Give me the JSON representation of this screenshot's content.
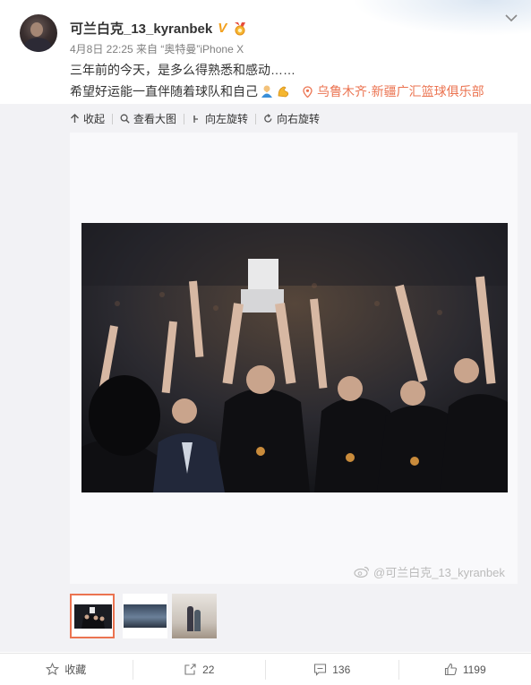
{
  "post": {
    "username": "可兰白克_13_kyranbek",
    "verified_badge": "V",
    "meta": "4月8日 22:25 来自 “奥特曼”iPhone X",
    "text_line1": "三年前的今天，是多么得熟悉和感动……",
    "text_line2": "希望好运能一直伴随着球队和自己",
    "location": "乌鲁木齐·新疆广汇篮球俱乐部"
  },
  "image_toolbar": {
    "collapse": "收起",
    "view_large": "查看大图",
    "rotate_left": "向左旋转",
    "rotate_right": "向右旋转"
  },
  "image": {
    "watermark": "@可兰白克_13_kyranbek",
    "thumbnail_count": 3,
    "selected_thumbnail": 1
  },
  "footer": {
    "favorite": "收藏",
    "repost_count": "22",
    "comment_count": "136",
    "like_count": "1199"
  },
  "icons": [
    "chevron-down-icon",
    "medal-icon",
    "location-pin-icon",
    "collapse-icon",
    "zoom-icon",
    "rotate-left-icon",
    "rotate-right-icon",
    "weibo-logo-icon",
    "star-icon",
    "repost-icon",
    "comment-icon",
    "like-icon"
  ],
  "colors": {
    "accent": "#eb7350",
    "verified": "#f2a01e",
    "panel": "#f2f2f5"
  }
}
